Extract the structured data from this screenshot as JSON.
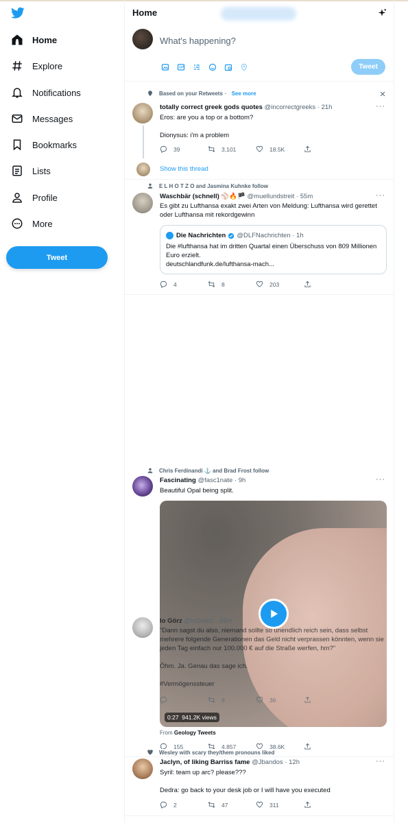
{
  "sidebar": {
    "logo": "twitter-bird-icon",
    "nav": [
      {
        "label": "Home",
        "icon": "home-icon",
        "active": true
      },
      {
        "label": "Explore",
        "icon": "hashtag-icon"
      },
      {
        "label": "Notifications",
        "icon": "bell-icon"
      },
      {
        "label": "Messages",
        "icon": "mail-icon"
      },
      {
        "label": "Bookmarks",
        "icon": "bookmark-icon"
      },
      {
        "label": "Lists",
        "icon": "list-icon"
      },
      {
        "label": "Profile",
        "icon": "person-icon"
      },
      {
        "label": "More",
        "icon": "more-circle-icon"
      }
    ],
    "tweet_button": "Tweet"
  },
  "header": {
    "title": "Home"
  },
  "composer": {
    "placeholder": "What's happening?",
    "tweet_button": "Tweet"
  },
  "colors": {
    "accent": "#1d9bf0",
    "text": "#0f1419",
    "muted": "#536471",
    "border": "#eff3f4"
  },
  "tweets": [
    {
      "context": "Based on your Retweets",
      "context_link": "See more",
      "name": "totally correct greek gods quotes",
      "handle": "@incorrectgreeks · 21h",
      "text": "Eros: are you a top or a bottom?\n\nDionysus: i'm a problem",
      "replies": "39",
      "retweets": "3,101",
      "likes": "18.5K",
      "show_thread": "Show this thread"
    },
    {
      "context": "E L   H O T Z O and Jasmina Kuhnke follow",
      "name": "Waschbär (schnell) ⚾️🔥🏴",
      "handle": "@muellundstreit · 55m",
      "text": "Es gibt zu Lufthansa exakt zwei Arten von Meldung: Lufthansa wird gerettet oder Lufthansa mit rekordgewinn",
      "quote": {
        "name": "Die Nachrichten",
        "handle": "@DLFNachrichten · 1h",
        "text": "Die #lufthansa hat im dritten Quartal einen Überschuss von 809 Millionen Euro erzielt.\ndeutschlandfunk.de/lufthansa-mach..."
      },
      "replies": "4",
      "retweets": "8",
      "likes": "203"
    },
    {
      "context": "Chris Ferdinandi ⚓ and Brad Frost follow",
      "name": "Fascinating",
      "handle": "@fasc1nate · 9h",
      "text": "Beautiful Opal being split.",
      "video_time": "0:27",
      "video_views": "941.2K views",
      "from_prefix": "From",
      "from": "Geology Tweets",
      "replies": "155",
      "retweets": "4,857",
      "likes": "38.6K"
    },
    {
      "name": "Io Görz",
      "handle": "@IoGoerz · 55m",
      "text": "\"Dann sagst du also, niemand sollte so unendlich reich sein, dass selbst mehrere folgende Generationen das Geld nicht verprassen könnten, wenn sie jeden Tag einfach nur 100.000  € auf die Straße werfen, hm?\"\n\nÖhm. Ja. Genau das sage ich.\n\n#Vermögenssteuer",
      "retweets": "9",
      "likes": "36"
    },
    {
      "context": "Wesley with scary they/them pronouns liked",
      "name": "Jaclyn, of liking Barriss fame",
      "handle": "@Jbandos · 12h",
      "text": "Syril: team up arc? please???\n\nDedra: go back to your desk job or I will have you executed",
      "replies": "2",
      "retweets": "47",
      "likes": "311"
    }
  ]
}
